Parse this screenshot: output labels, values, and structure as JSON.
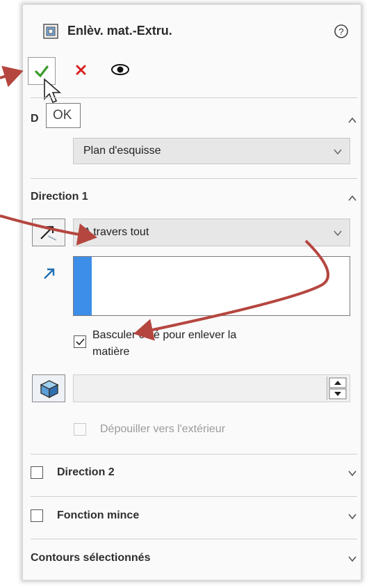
{
  "header": {
    "title": "Enlèv. mat.-Extru.",
    "icon": "extrude-cut-feature-icon",
    "help_icon": "help-icon"
  },
  "toolbar": {
    "ok_icon": "checkmark-icon",
    "cancel_icon": "close-icon",
    "preview_icon": "eye-icon",
    "tooltip": "OK"
  },
  "section_de": {
    "title_visible": "D",
    "dropdown_value": "Plan d'esquisse"
  },
  "direction1": {
    "title": "Direction 1",
    "end_condition": "A travers tout",
    "flip_label": "Basculer côté pour enlever la matière",
    "flip_line1": "Basculer côté pour enlever la",
    "flip_line2": "matière",
    "flip_checked": true,
    "draft_label": "Dépouiller vers l'extérieur",
    "draft_checked": false
  },
  "direction2": {
    "title": "Direction 2",
    "checked": false
  },
  "thin_feature": {
    "title": "Fonction mince",
    "checked": false
  },
  "selected_contours": {
    "title": "Contours sélectionnés"
  },
  "colors": {
    "accent_blue": "#3d8ee8",
    "ok_green": "#3a9a2a",
    "cancel_red": "#d82020",
    "annotation_arrow": "#b5463f",
    "direction_arrow": "#1f6fb5"
  }
}
